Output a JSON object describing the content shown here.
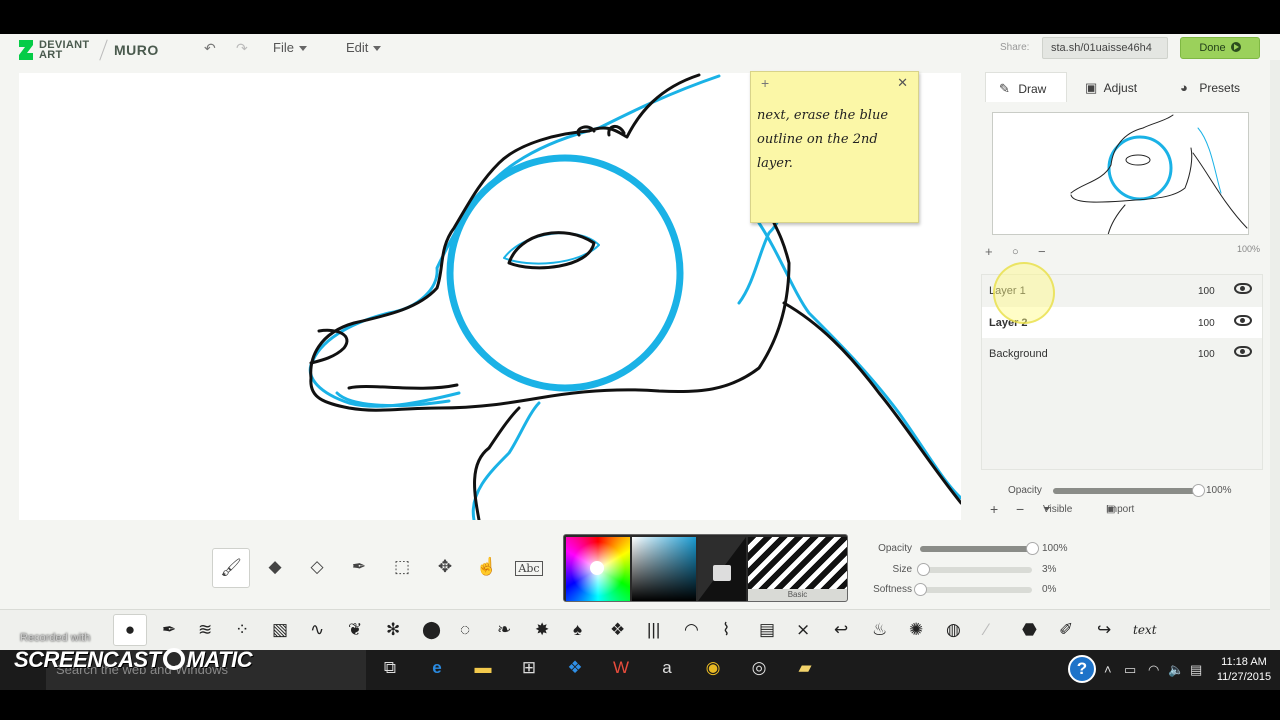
{
  "app": {
    "brand_line1": "DEVIANT",
    "brand_line2": "ART",
    "product": "MURO",
    "menu": [
      {
        "label": "File"
      },
      {
        "label": "Edit"
      }
    ],
    "share_label": "Share:",
    "share_url": "sta.sh/01uaisse46h4",
    "done_label": "Done"
  },
  "note": {
    "text": "next, erase the blue outline on the 2nd layer."
  },
  "panel": {
    "tabs": [
      {
        "label": "Draw",
        "icon": "brush-icon"
      },
      {
        "label": "Adjust",
        "icon": "image-icon"
      },
      {
        "label": "Presets",
        "icon": "palette-icon"
      }
    ],
    "zoom": "100%",
    "layers": [
      {
        "name": "Layer 1",
        "opacity": "100"
      },
      {
        "name": "Layer 2",
        "opacity": "100"
      },
      {
        "name": "Background",
        "opacity": "100"
      }
    ],
    "layer_opacity_label": "Opacity",
    "layer_opacity_value": "100%",
    "layer_opacity_fraction": 1.0,
    "visible_label": "Visible",
    "import_label": "Import"
  },
  "brush": {
    "picker_label": "Basic",
    "opacity_label": "Opacity",
    "opacity_value": "100%",
    "opacity_fraction": 1.0,
    "size_label": "Size",
    "size_value": "3%",
    "size_fraction": 0.03,
    "softness_label": "Softness",
    "softness_value": "0%",
    "softness_fraction": 0.0,
    "accent_color": "#1ab2e6"
  },
  "tools": [
    "brush-icon",
    "eraser-icon",
    "fill-icon",
    "eyedropper-icon",
    "selection-icon",
    "move-icon",
    "smudge-icon",
    "text-icon"
  ],
  "text_tool_label": "Abc",
  "brush_text_label": "text",
  "watermark": {
    "line1": "Recorded with",
    "line2a": "SCREENCAST",
    "line2b": "MATIC"
  },
  "taskbar": {
    "search_placeholder": "Search the web and Windows",
    "time": "11:18 AM",
    "date": "11/27/2015"
  }
}
